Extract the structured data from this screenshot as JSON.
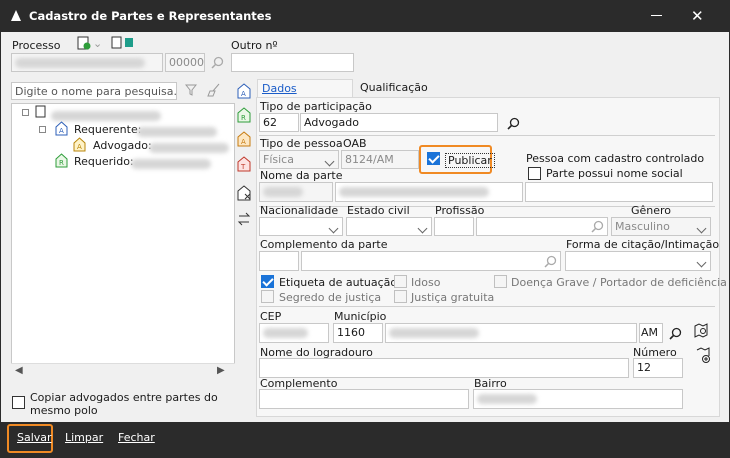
{
  "window": {
    "title": "Cadastro de Partes e Representantes"
  },
  "top": {
    "processo_label": "Processo",
    "processo_num": "00000",
    "outro_label": "Outro nº",
    "search_placeholder": "Digite o nome para pesquisa..."
  },
  "tree": {
    "requerente_label": "Requerente:",
    "advogado_label": "Advogado:",
    "requerido_label": "Requerido:"
  },
  "tabs": [
    {
      "label": "Dados principais",
      "active": true
    },
    {
      "label": "Qualificação",
      "active": false
    }
  ],
  "form": {
    "tipo_participacao_label": "Tipo de participação",
    "tipo_participacao_code": "62",
    "tipo_participacao_value": "Advogado",
    "tipo_pessoa_label": "Tipo de pessoa",
    "tipo_pessoa_value": "Física",
    "oab_label": "OAB",
    "oab_value": "8124/AM",
    "publicar_label": "Publicar",
    "pessoa_cadastro_label": "Pessoa com cadastro controlado",
    "nome_social_label": "Parte possui nome social",
    "nome_parte_label": "Nome da parte",
    "nacionalidade_label": "Nacionalidade",
    "estado_civil_label": "Estado civil",
    "profissao_label": "Profissão",
    "genero_label": "Gênero",
    "genero_value": "Masculino",
    "complemento_parte_label": "Complemento da parte",
    "forma_citacao_label": "Forma de citação/Intimação",
    "etiqueta_label": "Etiqueta de autuação",
    "idoso_label": "Idoso",
    "doenca_label": "Doença Grave / Portador de deficiência",
    "segredo_label": "Segredo de justiça",
    "justica_gratuita_label": "Justiça gratuita",
    "cep_label": "CEP",
    "municipio_label": "Município",
    "municipio_code": "1160",
    "municipio_uf": "AM",
    "logradouro_label": "Nome do logradouro",
    "numero_label": "Número",
    "numero_value": "12",
    "complemento_label": "Complemento",
    "bairro_label": "Bairro"
  },
  "copiar_label": "Copiar advogados entre partes do mesmo polo",
  "buttons": {
    "salvar": "Salvar",
    "limpar": "Limpar",
    "fechar": "Fechar"
  }
}
